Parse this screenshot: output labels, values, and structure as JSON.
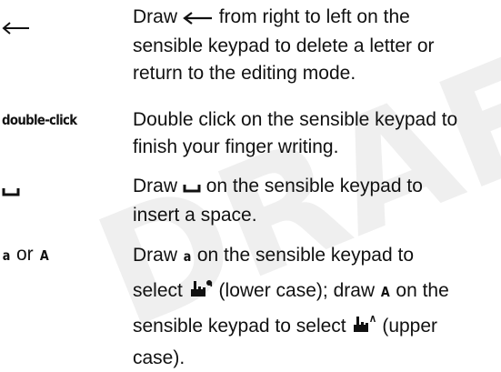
{
  "watermark": "DRAFT",
  "rows": [
    {
      "term_icon": "left-arrow-icon",
      "desc": {
        "l1_pre": "Draw",
        "l1_icon": "left-arrow-icon",
        "l1_post": "from right to left on the",
        "l2": "sensible keypad to delete a letter or",
        "l3": "return to the editing mode."
      }
    },
    {
      "term": "double-click",
      "desc": {
        "l1": "Double click on the sensible keypad to",
        "l2": "finish your finger writing."
      }
    },
    {
      "term_icon": "space-icon",
      "desc": {
        "l1_pre": "Draw",
        "l1_icon": "space-icon",
        "l1_post": "on the sensible keypad to",
        "l2": "insert a space."
      }
    },
    {
      "term_a": "a",
      "term_or": "or",
      "term_A": "A",
      "desc": {
        "l1_pre": "Draw",
        "l1_letter": "a",
        "l1_post": "on the sensible keypad to",
        "l2_pre": "select",
        "l2_icon": "handwriting-lowercase-icon",
        "l2_mid": "(lower case); draw",
        "l2_letter": "A",
        "l2_post": "on the",
        "l3_pre": "sensible keypad to select",
        "l3_icon": "handwriting-uppercase-icon",
        "l3_post": "(upper",
        "l4": "case)."
      }
    }
  ]
}
